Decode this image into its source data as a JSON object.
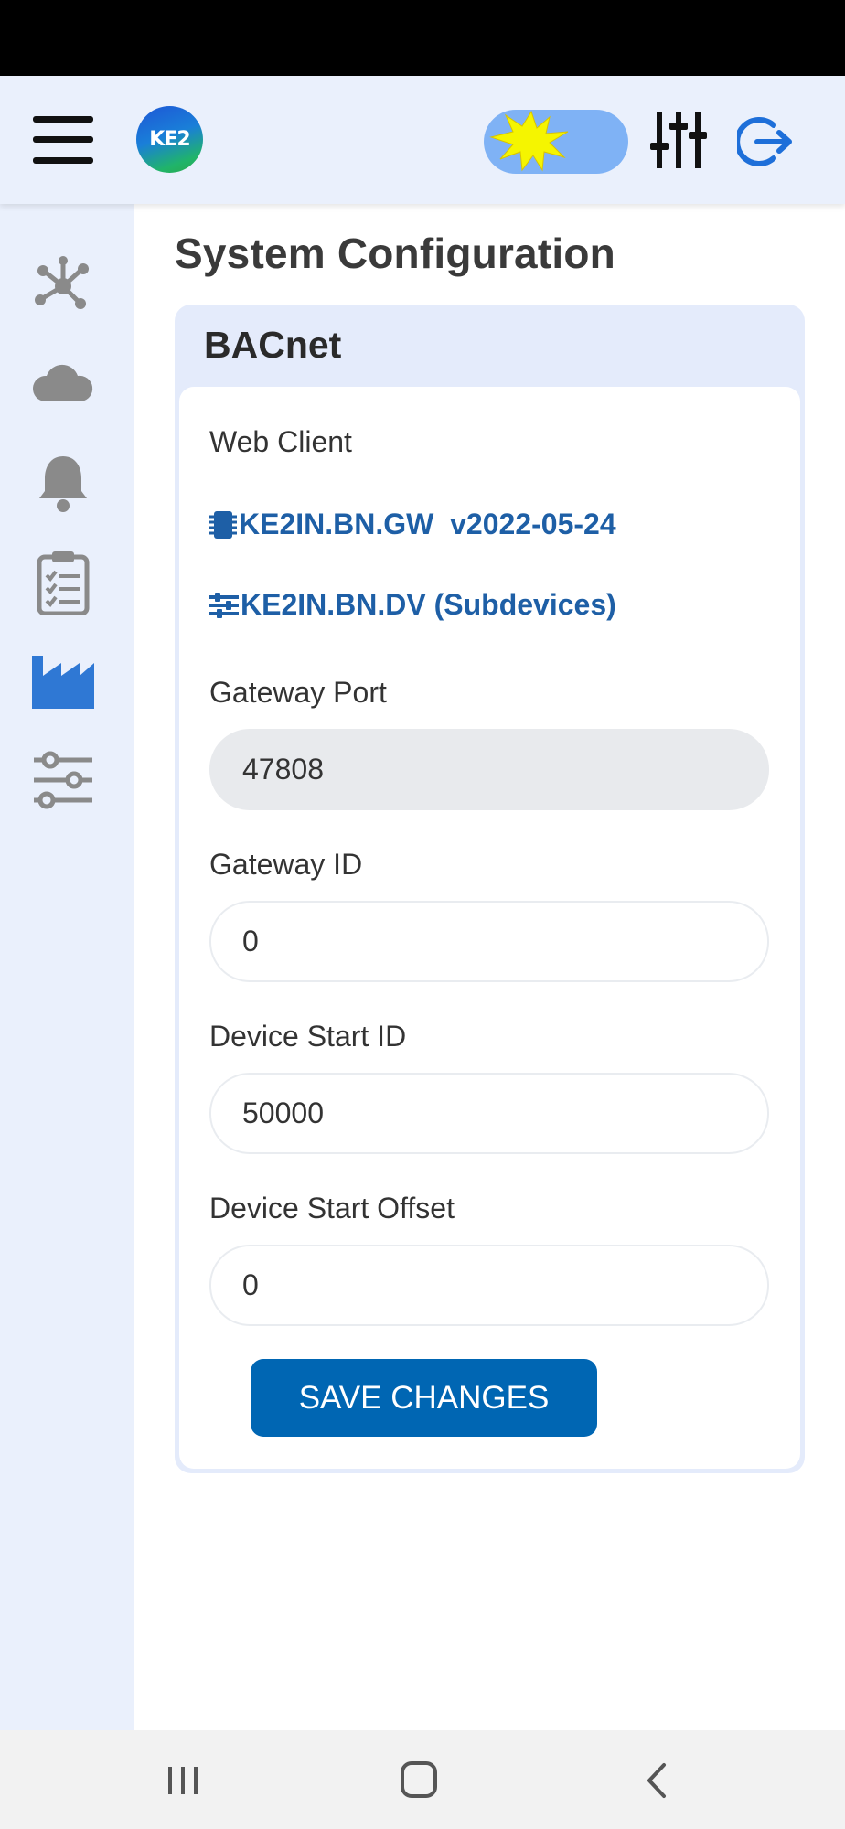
{
  "app": {
    "logo_text": "KE2",
    "page_title": "System Configuration"
  },
  "topbar": {
    "icons": [
      "menu-icon",
      "ke2-logo",
      "theme-toggle-sun-icon",
      "tune-icon",
      "logout-icon"
    ],
    "accent": "#1e6fd9"
  },
  "sidebar": {
    "items": [
      {
        "icon": "network-icon",
        "active": false
      },
      {
        "icon": "cloud-icon",
        "active": false
      },
      {
        "icon": "bell-icon",
        "active": false
      },
      {
        "icon": "clipboard-icon",
        "active": false
      },
      {
        "icon": "factory-icon",
        "active": true
      },
      {
        "icon": "sliders-icon",
        "active": false
      }
    ],
    "active_color": "#2f78d4",
    "inactive_color": "#8a8a8a"
  },
  "card": {
    "title": "BACnet",
    "web_client_label": "Web Client",
    "gateway_link": "KE2IN.BN.GW  v2022-05-24",
    "subdevices_link": "KE2IN.BN.DV (Subdevices)",
    "fields": {
      "gateway_port": {
        "label": "Gateway Port",
        "value": "47808"
      },
      "gateway_id": {
        "label": "Gateway ID",
        "value": "0"
      },
      "device_start_id": {
        "label": "Device Start ID",
        "value": "50000"
      },
      "device_start_offset": {
        "label": "Device Start Offset",
        "value": "0"
      }
    },
    "save_label": "SAVE CHANGES"
  },
  "colors": {
    "primary_button": "#0066b3",
    "link": "#1e5fa6",
    "header_bg": "#eaf0fc"
  }
}
